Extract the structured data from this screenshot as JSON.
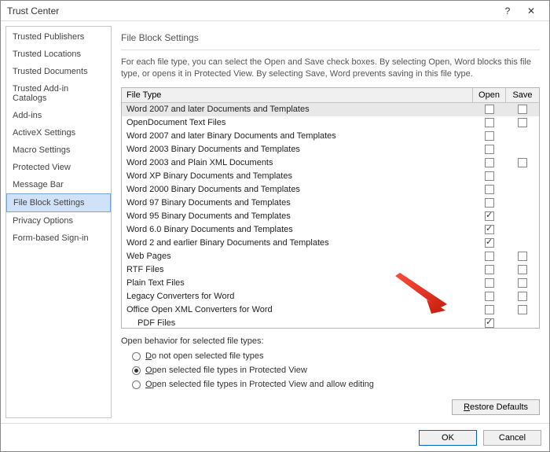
{
  "window": {
    "title": "Trust Center",
    "help": "?",
    "close": "✕"
  },
  "sidebar": {
    "items": [
      {
        "label": "Trusted Publishers"
      },
      {
        "label": "Trusted Locations"
      },
      {
        "label": "Trusted Documents"
      },
      {
        "label": "Trusted Add-in Catalogs"
      },
      {
        "label": "Add-ins"
      },
      {
        "label": "ActiveX Settings"
      },
      {
        "label": "Macro Settings"
      },
      {
        "label": "Protected View"
      },
      {
        "label": "Message Bar"
      },
      {
        "label": "File Block Settings",
        "selected": true
      },
      {
        "label": "Privacy Options"
      },
      {
        "label": "Form-based Sign-in"
      }
    ]
  },
  "content": {
    "heading": "File Block Settings",
    "description": "For each file type, you can select the Open and Save check boxes. By selecting Open, Word blocks this file type, or opens it in Protected View. By selecting Save, Word prevents saving in this file type.",
    "columns": {
      "filetype": "File Type",
      "open": "Open",
      "save": "Save"
    },
    "rows": [
      {
        "label": "Word 2007 and later Documents and Templates",
        "open": false,
        "save": false
      },
      {
        "label": "OpenDocument Text Files",
        "open": false,
        "save": false
      },
      {
        "label": "Word 2007 and later Binary Documents and Templates",
        "open": false,
        "save": null
      },
      {
        "label": "Word 2003 Binary Documents and Templates",
        "open": false,
        "save": null
      },
      {
        "label": "Word 2003 and Plain XML Documents",
        "open": false,
        "save": false
      },
      {
        "label": "Word XP Binary Documents and Templates",
        "open": false,
        "save": null
      },
      {
        "label": "Word 2000 Binary Documents and Templates",
        "open": false,
        "save": null
      },
      {
        "label": "Word 97 Binary Documents and Templates",
        "open": false,
        "save": null
      },
      {
        "label": "Word 95 Binary Documents and Templates",
        "open": true,
        "save": null
      },
      {
        "label": "Word 6.0 Binary Documents and Templates",
        "open": true,
        "save": null
      },
      {
        "label": "Word 2 and earlier Binary Documents and Templates",
        "open": true,
        "save": null
      },
      {
        "label": "Web Pages",
        "open": false,
        "save": false
      },
      {
        "label": "RTF Files",
        "open": false,
        "save": false
      },
      {
        "label": "Plain Text Files",
        "open": false,
        "save": false
      },
      {
        "label": "Legacy Converters for Word",
        "open": false,
        "save": false
      },
      {
        "label": "Office Open XML Converters for Word",
        "open": false,
        "save": false
      },
      {
        "label": "PDF Files",
        "open": true,
        "save": null,
        "indent": true
      }
    ],
    "openBehavior": {
      "label": "Open behavior for selected file types:",
      "options": [
        {
          "label": "Do not open selected file types",
          "checked": false
        },
        {
          "label": "Open selected file types in Protected View",
          "checked": true
        },
        {
          "label": "Open selected file types in Protected View and allow editing",
          "checked": false
        }
      ]
    },
    "restore": "Restore Defaults"
  },
  "dialog": {
    "ok": "OK",
    "cancel": "Cancel"
  }
}
